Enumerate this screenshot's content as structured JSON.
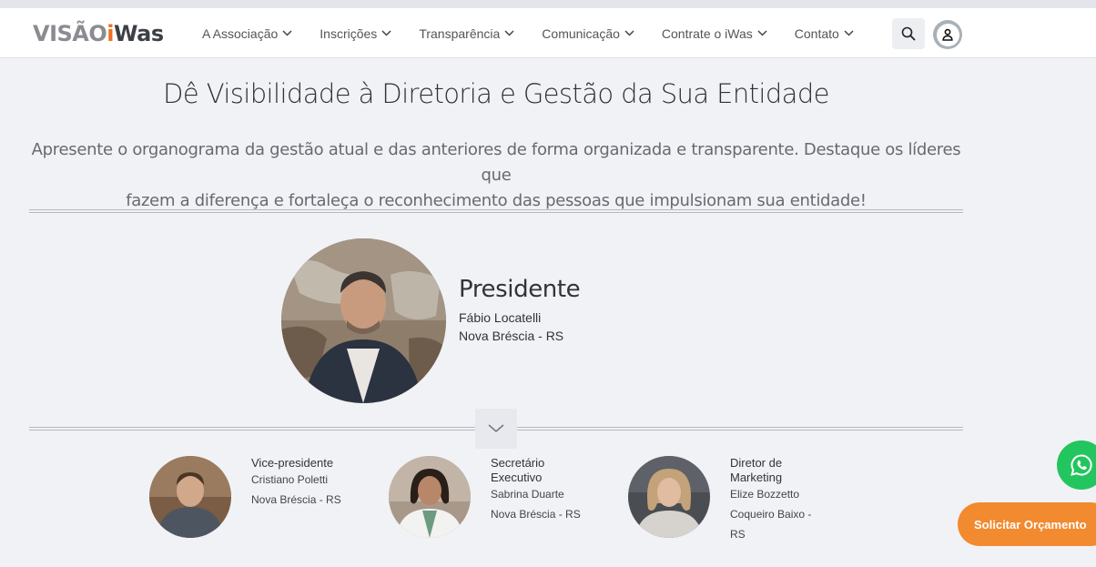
{
  "header": {
    "logo": {
      "part1": "VISÃO",
      "part2": "i",
      "part3": "Was"
    },
    "nav": [
      {
        "label": "A Associação"
      },
      {
        "label": "Inscrições"
      },
      {
        "label": "Transparência"
      },
      {
        "label": "Comunicação"
      },
      {
        "label": "Contrate o iWas"
      },
      {
        "label": "Contato"
      }
    ]
  },
  "main": {
    "title": "Dê Visibilidade à Diretoria e Gestão da Sua Entidade",
    "subtitle_line1": "Apresente o organograma da gestão atual e das anteriores de forma organizada e transparente. Destaque os líderes que",
    "subtitle_line2": "fazem a diferença e fortaleça o reconhecimento das pessoas que impulsionam sua entidade!",
    "president": {
      "role": "Presidente",
      "name": "Fábio Locatelli",
      "city": "Nova Bréscia - RS"
    },
    "members": [
      {
        "role": "Vice-presidente",
        "name": "Cristiano Poletti",
        "city": "Nova Bréscia - RS"
      },
      {
        "role": "Secretário Executivo",
        "name": "Sabrina Duarte",
        "city": "Nova Bréscia - RS"
      },
      {
        "role": "Diretor de Marketing",
        "name": "Elize Bozzetto",
        "city_line1": "Coqueiro Baixo -",
        "city_line2": "RS"
      }
    ]
  },
  "floating": {
    "quote_label": "Solicitar Orçamento"
  },
  "colors": {
    "accent": "#f06f22",
    "whatsapp": "#23c55e",
    "quote_button": "#f28a2f"
  },
  "icons": [
    "search-icon",
    "user-icon",
    "chevron-down-icon",
    "whatsapp-icon"
  ]
}
